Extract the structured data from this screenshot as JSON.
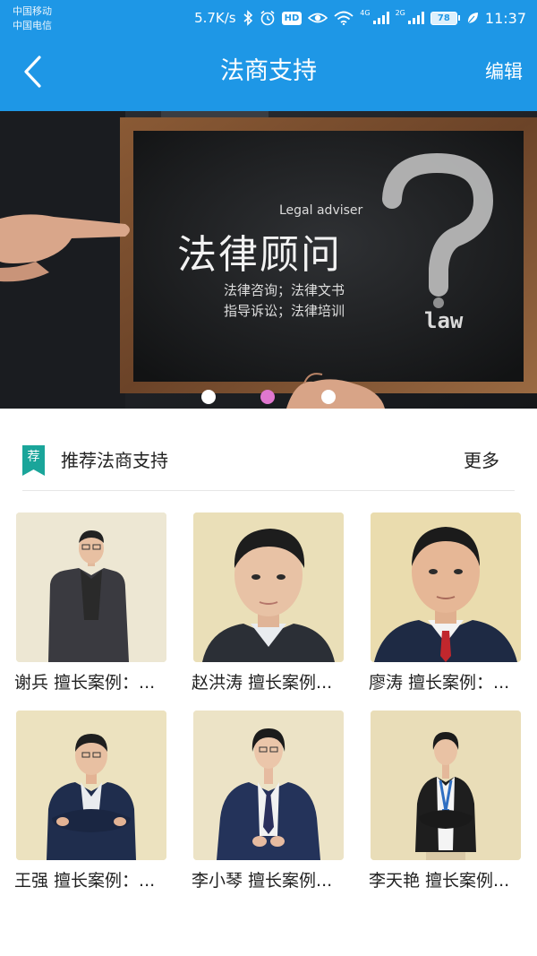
{
  "status_bar": {
    "carrier_1": "中国移动",
    "carrier_2": "中国电信",
    "net_speed": "5.7K/s",
    "hd_label": "HD",
    "net_type_1": "4G",
    "net_type_2": "2G",
    "battery": "78",
    "time": "11:37"
  },
  "nav": {
    "back_icon": "chevron-left-icon",
    "title": "法商支持",
    "edit_label": "编辑"
  },
  "banner": {
    "caption_en": "Legal adviser",
    "caption_title": "法律顾问",
    "caption_line1": "法律咨询；法律文书",
    "caption_line2": "指导诉讼；法律培训",
    "caption_law": "law",
    "slide_count": 3,
    "active_slide": 2
  },
  "section": {
    "badge": "荐",
    "title": "推荐法商支持",
    "more_label": "更多"
  },
  "lawyers": [
    {
      "caption": "谢兵 擅长案例：..."
    },
    {
      "caption": "赵洪涛 擅长案例..."
    },
    {
      "caption": "廖涛 擅长案例：..."
    },
    {
      "caption": "王强 擅长案例：..."
    },
    {
      "caption": "李小琴 擅长案例..."
    },
    {
      "caption": "李天艳 擅长案例..."
    }
  ],
  "colors": {
    "nav_bar": "#1e97e6",
    "badge_green": "#1aa59a",
    "active_dot": "#e077cf",
    "photo_bg": "#ece2bd"
  }
}
